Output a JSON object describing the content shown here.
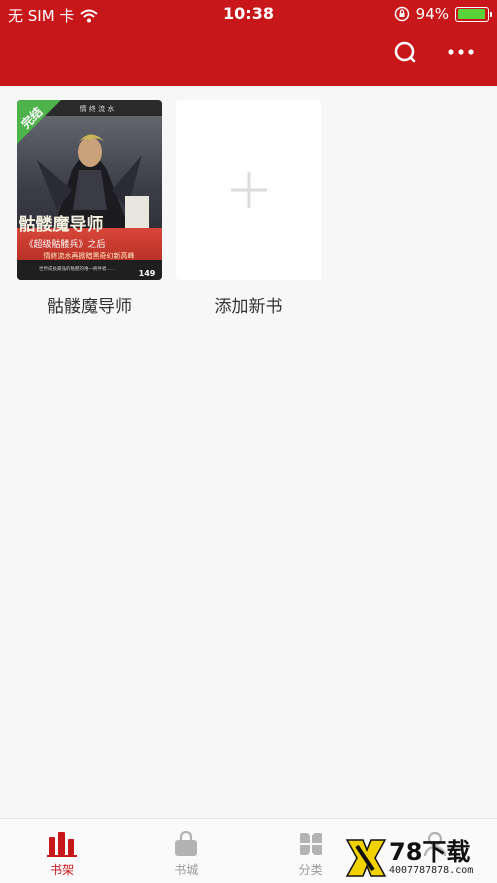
{
  "status": {
    "carrier": "无 SIM 卡",
    "time": "10:38",
    "battery_percent": "94%",
    "battery_level": 0.94,
    "wifi_icon": "wifi-icon",
    "lock_icon": "orientation-lock-icon"
  },
  "header": {
    "search_icon": "search-icon",
    "more_icon": "more-icon"
  },
  "shelf": {
    "books": [
      {
        "title": "骷髅魔导师",
        "badge": "完结",
        "cover_text_top": "情 终 流 水",
        "cover_title": "骷髅魔导师",
        "cover_subtitle": "《超级骷髅兵》之后",
        "cover_tagline": "情終流水再掀暗黑奇幻新高峰",
        "cover_small": "世界成長最強的骷髅的唯一終件者......",
        "cover_price": "149"
      }
    ],
    "add_book_label": "添加新书"
  },
  "tabs": [
    {
      "label": "书架",
      "icon": "bookshelf-icon",
      "active": true
    },
    {
      "label": "书城",
      "icon": "shopping-bag-icon",
      "active": false
    },
    {
      "label": "分类",
      "icon": "category-icon",
      "active": false
    },
    {
      "label": "",
      "icon": "user-icon",
      "active": false
    }
  ],
  "watermark": {
    "brand": "78下载",
    "phone": "4007787878.com"
  },
  "colors": {
    "brand_red": "#c8171b",
    "badge_green": "#4db34a",
    "battery_green": "#5ad33a"
  }
}
